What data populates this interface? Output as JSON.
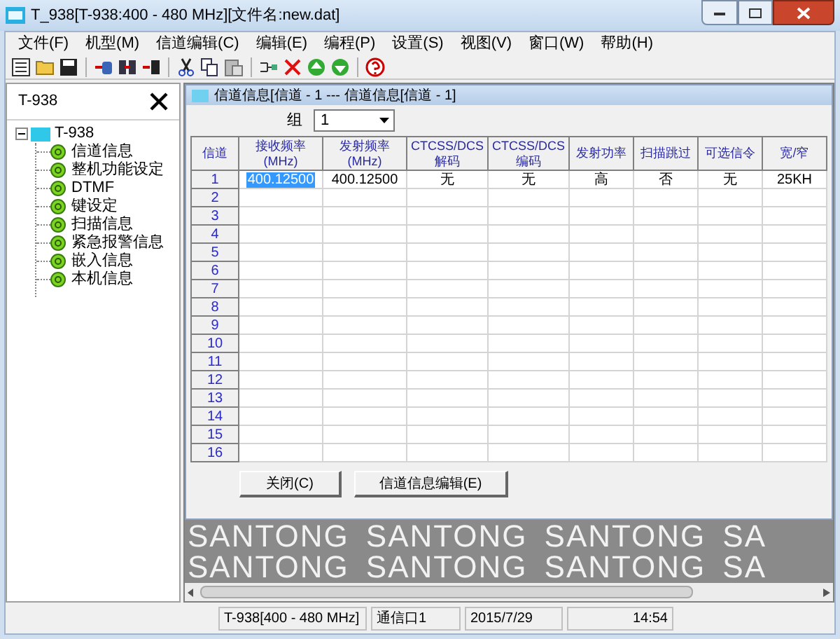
{
  "window": {
    "title": "T_938[T-938:400 - 480 MHz][文件名:new.dat]"
  },
  "menu": [
    "文件(F)",
    "机型(M)",
    "信道编辑(C)",
    "编辑(E)",
    "编程(P)",
    "设置(S)",
    "视图(V)",
    "窗口(W)",
    "帮助(H)"
  ],
  "side_panel": {
    "title": "T-938",
    "tree": {
      "label": "T-938",
      "expanded": true,
      "children": [
        {
          "label": "信道信息"
        },
        {
          "label": "整机功能设定"
        },
        {
          "label": "DTMF"
        },
        {
          "label": "键设定"
        },
        {
          "label": "扫描信息"
        },
        {
          "label": "紧急报警信息"
        },
        {
          "label": "嵌入信息"
        },
        {
          "label": "本机信息"
        }
      ]
    }
  },
  "child_window": {
    "title": "信道信息[信道 - 1 --- 信道信息[信道 - 1]",
    "group": {
      "label": "组",
      "value": "1"
    },
    "table": {
      "columns": [
        "信道",
        "接收频率(MHz)",
        "发射频率(MHz)",
        "CTCSS/DCS\n解码",
        "CTCSS/DCS\n编码",
        "发射功率",
        "扫描跳过",
        "可选信令",
        "宽/窄"
      ],
      "rows": [
        {
          "channel": "1",
          "cells": [
            {
              "text": "400.12500",
              "selected": true
            },
            {
              "text": "400.12500",
              "selected": false
            },
            {
              "text": "无",
              "selected": false
            },
            {
              "text": "无",
              "selected": false
            },
            {
              "text": "高",
              "selected": false
            },
            {
              "text": "否",
              "selected": false
            },
            {
              "text": "无",
              "selected": false
            },
            {
              "text": "25KH",
              "selected": false
            }
          ]
        },
        {
          "channel": "2"
        },
        {
          "channel": "3"
        },
        {
          "channel": "4"
        },
        {
          "channel": "5"
        },
        {
          "channel": "6"
        },
        {
          "channel": "7"
        },
        {
          "channel": "8"
        },
        {
          "channel": "9"
        },
        {
          "channel": "10"
        },
        {
          "channel": "11"
        },
        {
          "channel": "12"
        },
        {
          "channel": "13"
        },
        {
          "channel": "14"
        },
        {
          "channel": "15"
        },
        {
          "channel": "16"
        }
      ]
    },
    "buttons": [
      "关闭(C)",
      "信道信息编辑(E)"
    ]
  },
  "background_logo": [
    [
      "SANTONG",
      "SANTONG",
      "SANTONG",
      "SA"
    ],
    [
      "SANTONG",
      "SANTONG",
      "SANTONG",
      "SA"
    ]
  ],
  "status_bar": [
    "T-938[400 - 480 MHz]",
    "通信口1",
    "2015/7/29",
    "14:54"
  ]
}
